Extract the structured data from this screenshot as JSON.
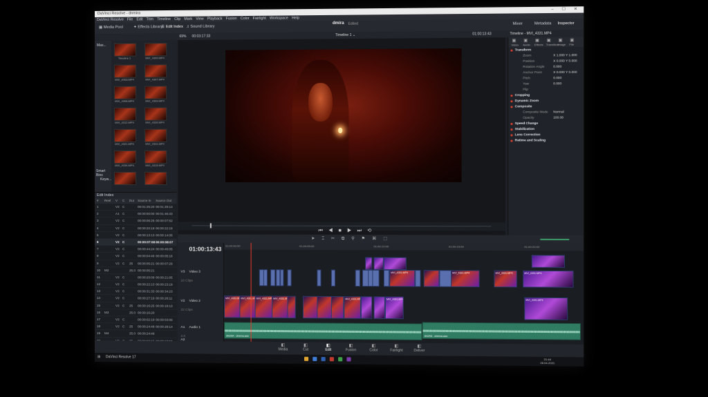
{
  "window": {
    "title": "DaVinci Resolve - dnmira",
    "controls": "– ☐ ✕"
  },
  "menu": [
    "DaVinci Resolve",
    "File",
    "Edit",
    "Trim",
    "Timeline",
    "Clip",
    "Mark",
    "View",
    "Playback",
    "Fusion",
    "Color",
    "Fairlight",
    "Workspace",
    "Help"
  ],
  "toolbar": {
    "media_pool": "Media Pool",
    "effects_library": "Effects Library",
    "edit_index": "Edit Index",
    "sound_library": "Sound Library",
    "project": "dmira",
    "edited": "Edited",
    "mixer": "Mixer",
    "metadata": "Metadata",
    "inspector": "Inspector"
  },
  "subbar": {
    "zoom": "69%",
    "timecode": "00:03:17:33",
    "timeline_name": "Timeline 1 ⌄",
    "timecode_right": "01:00:13:43",
    "inspector_title": "Timeline - MVI_4331.MP4"
  },
  "mediapool": {
    "side_label": "Mas...",
    "smart_bins": "Smart Bins",
    "keywords": "Keyw...",
    "thumbs": [
      "Timeline 1",
      "MVI_4300.MP4",
      "MVI_4303.MP4",
      "MVI_4307.MP4",
      "MVI_4308.MP4",
      "MVI_4309.MP4",
      "MVI_4312.MP4",
      "MVI_4330.MP4",
      "MVI_4321.MP4",
      "MVI_4331.MP4",
      "MVI_4334.MP4",
      "MVI_4315.MP4",
      "",
      ""
    ]
  },
  "editindex": {
    "title": "Edit Index",
    "columns": [
      "#",
      "Reel",
      "V",
      "C",
      "Dur",
      "Source In",
      "Source Out"
    ],
    "rows": [
      [
        "1",
        "",
        "V2",
        "C",
        "",
        "00:01:25:20",
        "00:01:28:14"
      ],
      [
        "2",
        "",
        "A1",
        "C",
        "",
        "00:00:00:00",
        "00:01:46:43"
      ],
      [
        "3",
        "",
        "V2",
        "C",
        "",
        "00:00:06:25",
        "00:00:07:52"
      ],
      [
        "4",
        "",
        "V2",
        "C",
        "",
        "00:00:20:19",
        "00:00:22:19"
      ],
      [
        "5",
        "",
        "V2",
        "C",
        "",
        "00:00:13:13",
        "00:00:14:05"
      ],
      [
        "6",
        "",
        "V2",
        "C",
        "",
        "00:00:07:08",
        "00:00:08:07"
      ],
      [
        "7",
        "",
        "V2",
        "C",
        "",
        "00:00:44:24",
        "00:00:46:05"
      ],
      [
        "8",
        "",
        "V2",
        "C",
        "",
        "00:00:04:49",
        "00:00:05:16"
      ],
      [
        "9",
        "",
        "V2",
        "C",
        "25",
        "00:00:05:21",
        "00:00:07:29"
      ],
      [
        "10",
        "M2",
        "",
        "",
        "25.0",
        "00:00:05:21",
        ""
      ],
      [
        "11",
        "",
        "V2",
        "C",
        "",
        "00:00:20:09",
        "00:00:21:05"
      ],
      [
        "12",
        "",
        "V2",
        "C",
        "",
        "00:00:22:13",
        "00:00:23:19"
      ],
      [
        "13",
        "",
        "V2",
        "C",
        "",
        "00:00:31:33",
        "00:00:34:23"
      ],
      [
        "14",
        "",
        "V2",
        "C",
        "",
        "00:00:27:19",
        "00:00:28:11"
      ],
      [
        "15",
        "",
        "V2",
        "C",
        "25",
        "00:00:16:25",
        "00:00:18:13"
      ],
      [
        "16",
        "M3",
        "",
        "",
        "25.0",
        "00:00:16:20",
        ""
      ],
      [
        "17",
        "",
        "V2",
        "C",
        "",
        "00:00:02:19",
        "00:00:03:06"
      ],
      [
        "18",
        "",
        "V2",
        "C",
        "25",
        "00:00:24:48",
        "00:00:28:14"
      ],
      [
        "19",
        "M4",
        "",
        "",
        "25.0",
        "00:00:24:48",
        ""
      ],
      [
        "20",
        "",
        "V2",
        "C",
        "25",
        "00:00:08:15",
        "00:00:10:15"
      ],
      [
        "21",
        "",
        "V2",
        "C",
        "25",
        "00:00:08:15",
        ""
      ]
    ],
    "selected_row": 6
  },
  "inspector": {
    "tabs": [
      "Video",
      "Audio",
      "Effects",
      "Transition",
      "Image",
      "File"
    ],
    "transform": "Transform",
    "props": [
      {
        "k": "Zoom",
        "v": "X 1.000   Y 1.000"
      },
      {
        "k": "Position",
        "v": "X 0.000   Y 0.000"
      },
      {
        "k": "Rotation Angle",
        "v": "0.000"
      },
      {
        "k": "Anchor Point",
        "v": "X 0.000   Y 0.000"
      },
      {
        "k": "Pitch",
        "v": "0.000"
      },
      {
        "k": "Yaw",
        "v": "0.000"
      },
      {
        "k": "Flip",
        "v": ""
      }
    ],
    "sections": [
      "Cropping",
      "Dynamic Zoom",
      "Composite"
    ],
    "composite_mode_label": "Composite Mode",
    "composite_mode_value": "Normal",
    "opacity_label": "Opacity",
    "opacity_value": "100.00",
    "sections2": [
      "Speed Change",
      "Stabilization",
      "Lens Correction",
      "Retime and Scaling"
    ]
  },
  "timeline": {
    "timecode": "01:00:13:43",
    "ruler": [
      "01:00:00:00",
      "01:00:05:00",
      "01:00:10:00",
      "01:00:15:00",
      "01:00:20:00"
    ],
    "tracks": [
      {
        "id": "V3",
        "name": "Video 3",
        "sub": "10 Clips"
      },
      {
        "id": "V2",
        "name": "Video 2",
        "sub": "22 Clips"
      },
      {
        "id": "A1",
        "name": "Audio 1",
        "sub": "2.0"
      },
      {
        "id": "A2",
        "name": "",
        "sub": ""
      }
    ],
    "audio_clip_a": "dnUSA - cinema.wav",
    "audio_clip_b": "dnUSA - cinema.wav",
    "clip_label": "MVI_4331.MP4"
  },
  "pages": [
    "Media",
    "Cut",
    "Edit",
    "Fusion",
    "Color",
    "Fairlight",
    "Deliver"
  ],
  "active_page": "Edit",
  "taskbar": {
    "app": "DaVinci Resolve 17",
    "time": "21:44",
    "date": "28.04.2021"
  }
}
